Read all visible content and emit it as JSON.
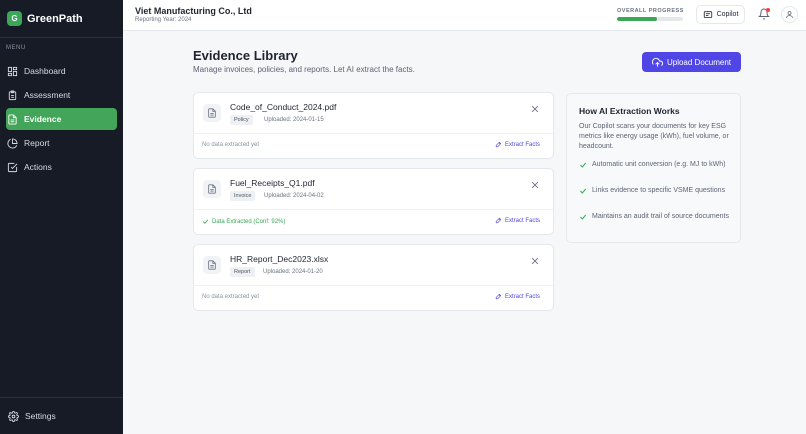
{
  "brand": {
    "logo_letter": "G",
    "name": "GreenPath"
  },
  "sidebar": {
    "menu_label": "MENU",
    "items": [
      {
        "label": "Dashboard",
        "icon": "grid-icon",
        "active": false
      },
      {
        "label": "Assessment",
        "icon": "clipboard-icon",
        "active": false
      },
      {
        "label": "Evidence",
        "icon": "file-icon",
        "active": true
      },
      {
        "label": "Report",
        "icon": "pie-chart-icon",
        "active": false
      },
      {
        "label": "Actions",
        "icon": "checkbox-icon",
        "active": false
      }
    ],
    "settings_label": "Settings"
  },
  "header": {
    "company": "Viet Manufacturing Co., Ltd",
    "reporting_year": "Reporting Year: 2024",
    "progress_label": "OVERALL PROGRESS",
    "progress_fraction": 0.6,
    "copilot_label": "Copilot",
    "notification_unread": true
  },
  "main": {
    "title": "Evidence Library",
    "description": "Manage invoices, policies, and reports. Let AI extract the facts.",
    "upload_label": "Upload Document",
    "documents": [
      {
        "name": "Code_of_Conduct_2024.pdf",
        "type": "Policy",
        "uploaded": "Uploaded: 2024-01-15",
        "status": "No data extracted yet",
        "extracted": false,
        "extract_label": "Extract Facts"
      },
      {
        "name": "Fuel_Receipts_Q1.pdf",
        "type": "Invoice",
        "uploaded": "Uploaded: 2024-04-02",
        "status": "Data Extracted (Conf: 92%)",
        "extracted": true,
        "extract_label": "Extract Facts"
      },
      {
        "name": "HR_Report_Dec2023.xlsx",
        "type": "Report",
        "uploaded": "Uploaded: 2024-01-20",
        "status": "No data extracted yet",
        "extracted": false,
        "extract_label": "Extract Facts"
      }
    ]
  },
  "info_panel": {
    "title": "How AI Extraction Works",
    "description": "Our Copilot scans your documents for key ESG metrics like energy usage (kWh), fuel volume, or headcount.",
    "bullets": [
      "Automatic unit conversion (e.g. MJ to kWh)",
      "Links evidence to specific VSME questions",
      "Maintains an audit trail of source documents"
    ]
  },
  "colors": {
    "accent": "#4f46e5",
    "brand_green": "#3aa858",
    "sidebar_bg": "#161b26",
    "alert": "#ef4444"
  }
}
